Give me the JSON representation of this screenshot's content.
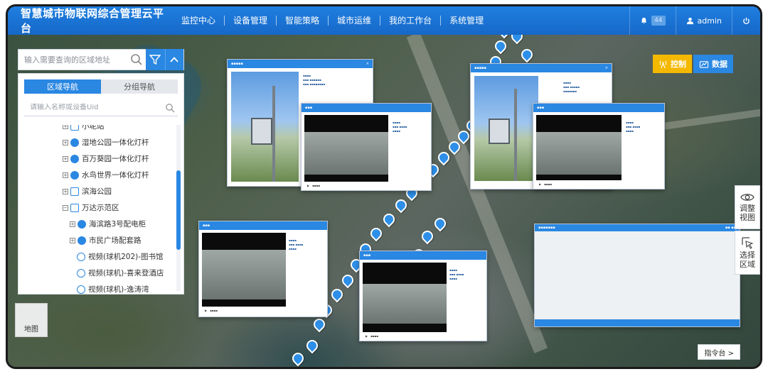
{
  "app": {
    "title": "智慧城市物联网综合管理云平台"
  },
  "nav": {
    "items": [
      {
        "label": "监控中心"
      },
      {
        "label": "设备管理"
      },
      {
        "label": "智能策略"
      },
      {
        "label": "城市运维"
      },
      {
        "label": "我的工作台"
      },
      {
        "label": "系统管理"
      }
    ]
  },
  "header": {
    "notification_count": "44",
    "user": "admin"
  },
  "search": {
    "placeholder": "输入需要查询的区域地址"
  },
  "tree": {
    "tabs": [
      {
        "label": "区域导航"
      },
      {
        "label": "分组导航"
      }
    ],
    "search_placeholder": "请输入名称或设备Uid",
    "items": [
      {
        "label": "小坭站",
        "type": "house",
        "indent": 0
      },
      {
        "label": "湿地公园一体化灯杆",
        "type": "pole",
        "indent": 0
      },
      {
        "label": "百万葵园一体化灯杆",
        "type": "pole",
        "indent": 0
      },
      {
        "label": "水鸟世界一体化灯杆",
        "type": "pole",
        "indent": 0
      },
      {
        "label": "滨海公园",
        "type": "house",
        "indent": 0
      },
      {
        "label": "万达示范区",
        "type": "house",
        "indent": 0
      },
      {
        "label": "海滨路3号配电柜",
        "type": "pole",
        "indent": 1
      },
      {
        "label": "市民广场配套路",
        "type": "pole",
        "indent": 1
      },
      {
        "label": "视频(球机202)-图书馆",
        "type": "cam",
        "indent": 2
      },
      {
        "label": "视频(球机)-喜来登酒店",
        "type": "cam",
        "indent": 2
      },
      {
        "label": "视频(球机)-逸涛湾",
        "type": "cam",
        "indent": 2
      }
    ]
  },
  "map": {
    "type_label": "地图"
  },
  "controls": {
    "control_label": "控制",
    "data_label": "数据"
  },
  "tools": {
    "adjust_view": "调整视图",
    "select_area": "选择区域"
  },
  "console": {
    "label": "指令台 >"
  },
  "colors": {
    "primary": "#2a87e2",
    "header": "#1f7fe0",
    "control": "#f5b800"
  }
}
